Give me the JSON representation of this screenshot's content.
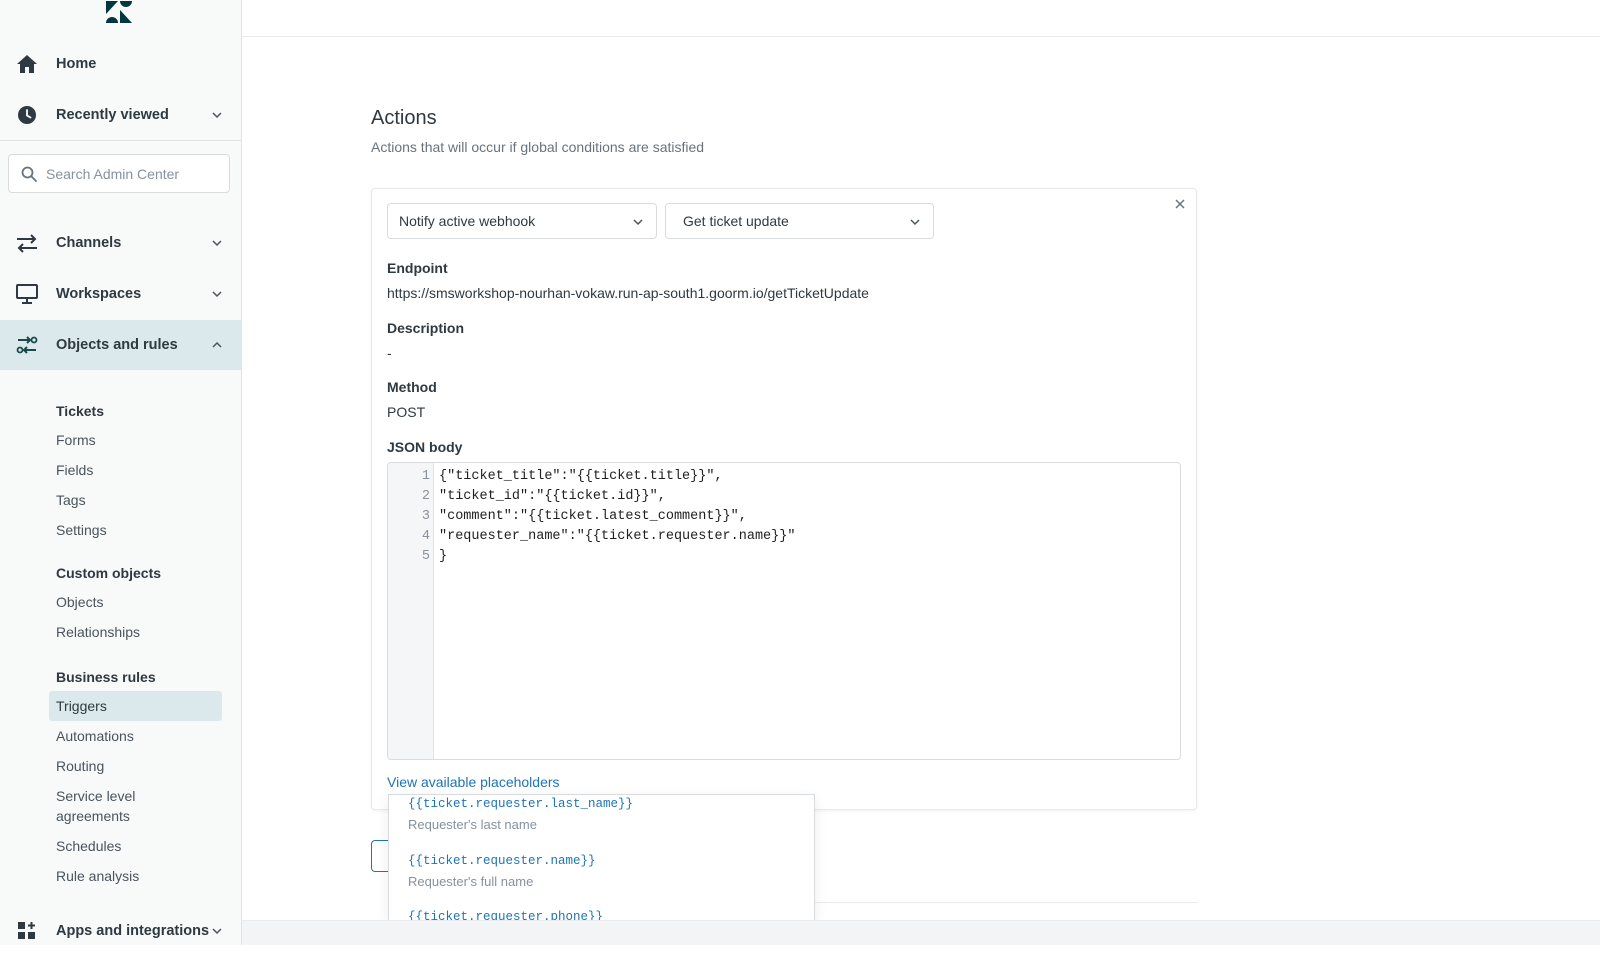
{
  "sidebar": {
    "nav": {
      "home": "Home",
      "recently_viewed": "Recently viewed",
      "channels": "Channels",
      "workspaces": "Workspaces",
      "objects_and_rules": "Objects and rules",
      "apps_and_integrations": "Apps and integrations"
    },
    "search_placeholder": "Search Admin Center",
    "tickets_heading": "Tickets",
    "tickets_items": [
      "Forms",
      "Fields",
      "Tags",
      "Settings"
    ],
    "custom_objects_heading": "Custom objects",
    "custom_objects_items": [
      "Objects",
      "Relationships"
    ],
    "business_rules_heading": "Business rules",
    "business_rules_items": [
      "Triggers",
      "Automations",
      "Routing",
      "Service level",
      "agreements",
      "Schedules",
      "Rule analysis"
    ]
  },
  "main": {
    "title": "Actions",
    "subtitle": "Actions that will occur if global conditions are satisfied",
    "action_type": "Notify active webhook",
    "webhook": "Get ticket update",
    "endpoint_label": "Endpoint",
    "endpoint_value": "https://smsworkshop-nourhan-vokaw.run-ap-south1.goorm.io/getTicketUpdate",
    "description_label": "Description",
    "description_value": "-",
    "method_label": "Method",
    "method_value": "POST",
    "json_label": "JSON body",
    "json_lines": [
      {
        "n": "1",
        "code": "{\"ticket_title\":\"{{ticket.title}}\","
      },
      {
        "n": "2",
        "code": "\"ticket_id\":\"{{ticket.id}}\","
      },
      {
        "n": "3",
        "code": "\"comment\":\"{{ticket.latest_comment}}\","
      },
      {
        "n": "4",
        "code": "\"requester_name\":\"{{ticket.requester.name}}\""
      },
      {
        "n": "5",
        "code": "}"
      }
    ],
    "placeholders_link": "View available placeholders",
    "placeholders": [
      {
        "code": "{{ticket.requester.last_name}}",
        "desc": "Requester's last name"
      },
      {
        "code": "{{ticket.requester.name}}",
        "desc": "Requester's full name"
      },
      {
        "code": "{{ticket.requester.phone}}",
        "desc": ""
      }
    ]
  },
  "colors": {
    "accent": "#1f73b7",
    "active_nav": "#dce9ec",
    "sidebar_bg": "#f8f9f9"
  }
}
